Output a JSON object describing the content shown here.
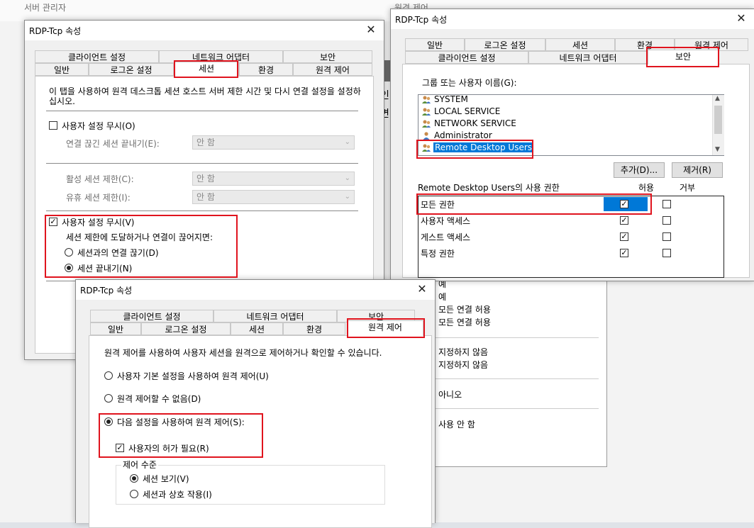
{
  "background": {
    "title_left": "서버 관리자",
    "title_right": "원격 제어",
    "values": [
      "예",
      "예",
      "모든 연결 허용",
      "모든 연결 허용",
      "지정하지 않음",
      "지정하지 않음",
      "아니오",
      "사용 안 함"
    ],
    "right_letters": [
      "인",
      "면"
    ]
  },
  "win1": {
    "title": "RDP-Tcp 속성",
    "tabs_back": [
      "클라이언트 설정",
      "네트워크 어댑터",
      "보안"
    ],
    "tabs_front": [
      "일반",
      "로그온 설정",
      "세션",
      "환경",
      "원격 제어"
    ],
    "description": "이 탭을 사용하여 원격 데스크톱 세션 호스트 서버 제한 시간 및 다시 연결 설정을 설정하십시오.",
    "override1_label": "사용자 설정 무시(O)",
    "disconnected_label": "연결 끊긴 세션 끝내기(E):",
    "disconnected_value": "안 함",
    "active_label": "활성 세션 제한(C):",
    "active_value": "안 함",
    "idle_label": "유휴 세션 제한(I):",
    "idle_value": "안 함",
    "override2_label": "사용자 설정 무시(V)",
    "limit_label": "세션 제한에 도달하거나 연결이 끊어지면:",
    "radio_disconnect": "세션과의 연결 끊기(D)",
    "radio_end": "세션 끝내기(N)"
  },
  "win2": {
    "title": "RDP-Tcp 속성",
    "tabs_back": [
      "일반",
      "로그온 설정",
      "세션",
      "환경",
      "원격 제어"
    ],
    "tabs_front": [
      "클라이언트 설정",
      "네트워크 어댑터",
      "보안"
    ],
    "group_label": "그룹 또는 사용자 이름(G):",
    "users": [
      "SYSTEM",
      "LOCAL SERVICE",
      "NETWORK SERVICE",
      "Administrator",
      "Remote Desktop Users"
    ],
    "add_button": "추가(D)...",
    "remove_button": "제거(R)",
    "perm_label": "Remote Desktop Users의 사용 권한",
    "allow_header": "허용",
    "deny_header": "거부",
    "perms": [
      "모든 권한",
      "사용자 액세스",
      "게스트 액세스",
      "특정 권한"
    ]
  },
  "win3": {
    "title": "RDP-Tcp 속성",
    "tabs_back": [
      "클라이언트 설정",
      "네트워크 어댑터",
      "보안"
    ],
    "tabs_front": [
      "일반",
      "로그온 설정",
      "세션",
      "환경",
      "원격 제어"
    ],
    "description": "원격 제어를 사용하여 사용자 세션을 원격으로 제어하거나 확인할 수 있습니다.",
    "radio_default": "사용자 기본 설정을 사용하여 원격 제어(U)",
    "radio_none": "원격 제어할 수 없음(D)",
    "radio_custom": "다음 설정을 사용하여 원격 제어(S):",
    "require_permission": "사용자의 허가 필요(R)",
    "level_label": "제어 수준",
    "view_session": "세션 보기(V)",
    "interact_session": "세션과 상호 작용(I)"
  }
}
